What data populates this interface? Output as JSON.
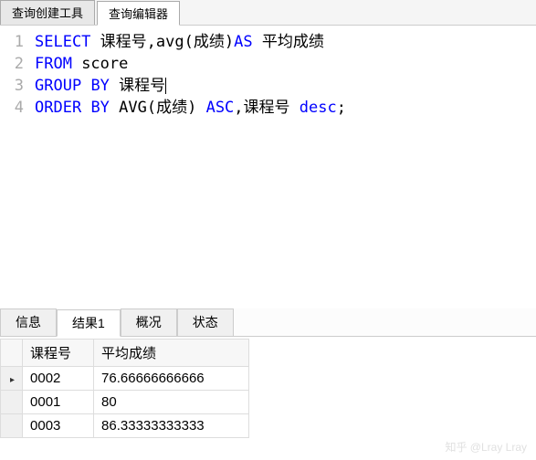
{
  "topTabs": [
    {
      "label": "查询创建工具",
      "active": false
    },
    {
      "label": "查询编辑器",
      "active": true
    }
  ],
  "editor": {
    "lines": [
      {
        "num": "1",
        "tokens": [
          {
            "t": "SELECT",
            "c": "kw"
          },
          {
            "t": " 课程号,",
            "c": "id"
          },
          {
            "t": "avg",
            "c": "fn"
          },
          {
            "t": "(成绩)",
            "c": "id"
          },
          {
            "t": "AS",
            "c": "kw"
          },
          {
            "t": " 平均成绩",
            "c": "id"
          }
        ]
      },
      {
        "num": "2",
        "tokens": [
          {
            "t": "FROM",
            "c": "kw"
          },
          {
            "t": " score",
            "c": "id"
          }
        ]
      },
      {
        "num": "3",
        "tokens": [
          {
            "t": "GROUP",
            "c": "kw"
          },
          {
            "t": " ",
            "c": "id"
          },
          {
            "t": "BY",
            "c": "kw"
          },
          {
            "t": " 课程号",
            "c": "id"
          }
        ],
        "cursor": true
      },
      {
        "num": "4",
        "tokens": [
          {
            "t": "ORDER",
            "c": "kw"
          },
          {
            "t": " ",
            "c": "id"
          },
          {
            "t": "BY",
            "c": "kw"
          },
          {
            "t": " AVG(成绩) ",
            "c": "id"
          },
          {
            "t": "ASC",
            "c": "kw"
          },
          {
            "t": ",课程号 ",
            "c": "id"
          },
          {
            "t": "desc",
            "c": "kw"
          },
          {
            "t": ";",
            "c": "id"
          }
        ]
      }
    ]
  },
  "bottomTabs": [
    {
      "label": "信息",
      "active": false
    },
    {
      "label": "结果1",
      "active": true
    },
    {
      "label": "概况",
      "active": false
    },
    {
      "label": "状态",
      "active": false
    }
  ],
  "results": {
    "columns": [
      "课程号",
      "平均成绩"
    ],
    "rows": [
      {
        "marker": "▸",
        "cells": [
          "0002",
          "76.66666666666"
        ]
      },
      {
        "marker": "",
        "cells": [
          "0001",
          "80"
        ]
      },
      {
        "marker": "",
        "cells": [
          "0003",
          "86.33333333333"
        ]
      }
    ]
  },
  "watermark": "知乎 @Lray Lray"
}
